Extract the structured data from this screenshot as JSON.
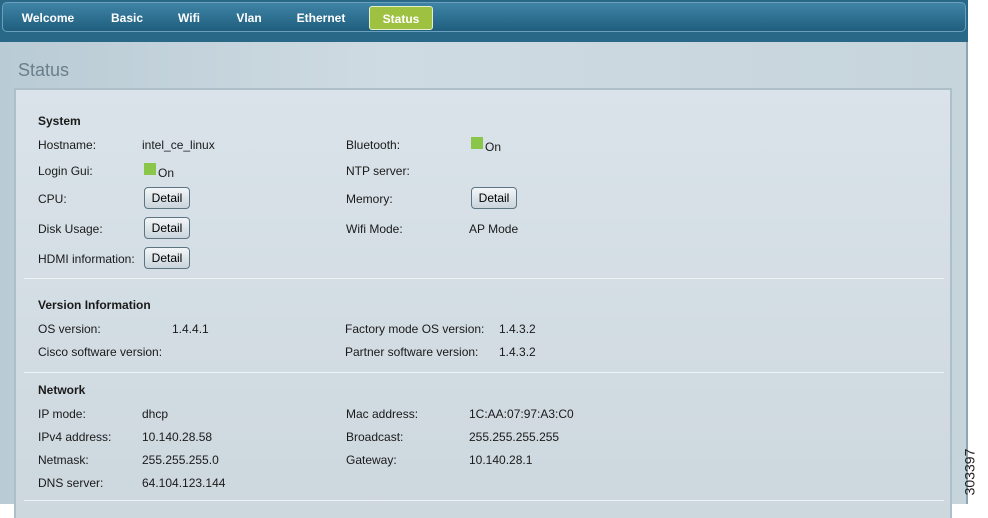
{
  "nav": {
    "tabs": [
      {
        "label": "Welcome"
      },
      {
        "label": "Basic"
      },
      {
        "label": "Wifi"
      },
      {
        "label": "Vlan"
      },
      {
        "label": "Ethernet"
      },
      {
        "label": "Status",
        "active": true
      }
    ]
  },
  "page_title": "Status",
  "system": {
    "title": "System",
    "hostname_label": "Hostname:",
    "hostname": "intel_ce_linux",
    "bluetooth_label": "Bluetooth:",
    "bluetooth": "On",
    "login_gui_label": "Login Gui:",
    "login_gui": "On",
    "ntp_label": "NTP server:",
    "cpu_label": "CPU:",
    "memory_label": "Memory:",
    "disk_label": "Disk Usage:",
    "wifi_mode_label": "Wifi Mode:",
    "wifi_mode": "AP Mode",
    "hdmi_label": "HDMI information:",
    "detail_label": "Detail"
  },
  "version": {
    "title": "Version Information",
    "os_label": "OS version:",
    "os": "1.4.4.1",
    "factory_label": "Factory mode OS version:",
    "factory": "1.4.3.2",
    "cisco_label": "Cisco software version:",
    "partner_label": "Partner software version:",
    "partner": "1.4.3.2"
  },
  "network": {
    "title": "Network",
    "ip_mode_label": "IP mode:",
    "ip_mode": "dhcp",
    "mac_label": "Mac address:",
    "mac": "1C:AA:07:97:A3:C0",
    "ipv4_label": "IPv4 address:",
    "ipv4": "10.140.28.58",
    "broadcast_label": "Broadcast:",
    "broadcast": "255.255.255.255",
    "netmask_label": "Netmask:",
    "netmask": "255.255.255.0",
    "gateway_label": "Gateway:",
    "gateway": "10.140.28.1",
    "dns_label": "DNS server:",
    "dns": "64.104.123.144"
  },
  "colors": {
    "nav": "#1f5e7e",
    "active_tab": "#9fc142",
    "led_on": "#8ac64a"
  },
  "figure_id": "303397"
}
